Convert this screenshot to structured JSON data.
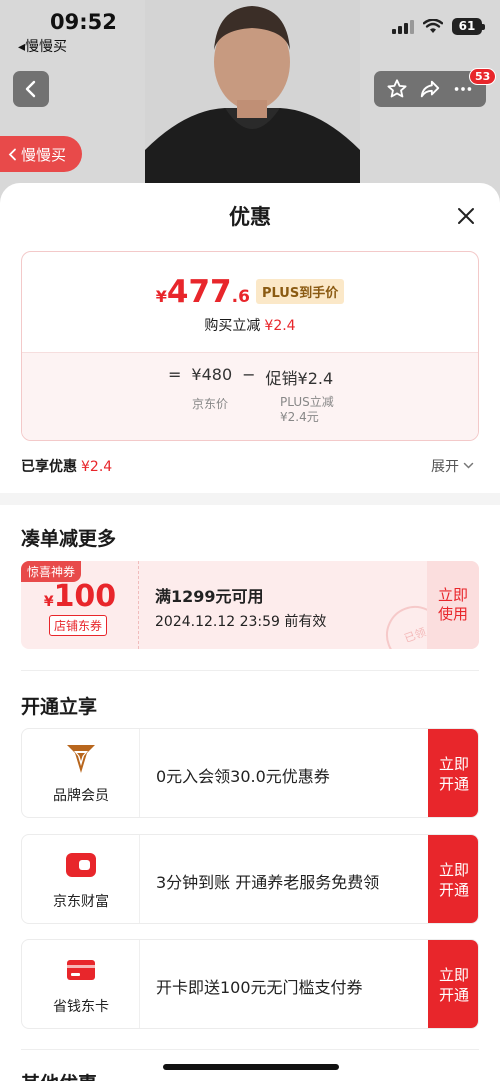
{
  "status_bar": {
    "time": "09:52",
    "battery": "61",
    "app_back_label": "慢慢买"
  },
  "product_nav": {
    "badge_count": "53",
    "slow_buy_label": "慢慢买"
  },
  "sheet": {
    "title": "优惠",
    "price_card": {
      "currency": "¥",
      "price_integer": "477",
      "price_decimal": ".6",
      "plus_tag": "PLUS到手价",
      "buy_reduce_label": "购买立减",
      "buy_reduce_value": "¥2.4",
      "formula_equals": "=",
      "formula_base": "¥480",
      "formula_minus": "−",
      "formula_promo": "促销¥2.4",
      "sub_jd_price": "京东价",
      "sub_plus_line1": "PLUS立减",
      "sub_plus_line2": "¥2.4元"
    },
    "enjoyed_label": "已享优惠",
    "enjoyed_value": "¥2.4",
    "expand_label": "展开",
    "more_section_title": "凑单减更多",
    "coupon": {
      "tag": "惊喜神券",
      "currency": "¥",
      "amount": "100",
      "type": "店铺东券",
      "condition": "满1299元可用",
      "expiry": "2024.12.12 23:59 前有效",
      "button_line1": "立即",
      "button_line2": "使用",
      "stamp": "已领"
    },
    "open_section_title": "开通立享",
    "memberships": [
      {
        "label": "品牌会员",
        "text": "0元入会领30.0元优惠券",
        "btn1": "立即",
        "btn2": "开通",
        "icon": "brand-member-icon"
      },
      {
        "label": "京东财富",
        "text": "3分钟到账 开通养老服务免费领",
        "btn1": "立即",
        "btn2": "开通",
        "icon": "jd-wealth-icon"
      },
      {
        "label": "省钱东卡",
        "text": "开卡即送100元无门槛支付券",
        "btn1": "立即",
        "btn2": "开通",
        "icon": "savings-card-icon"
      }
    ],
    "other_section_title": "其他优惠"
  },
  "colors": {
    "accent": "#e8262b",
    "plus_gold": "#8a5a12"
  }
}
